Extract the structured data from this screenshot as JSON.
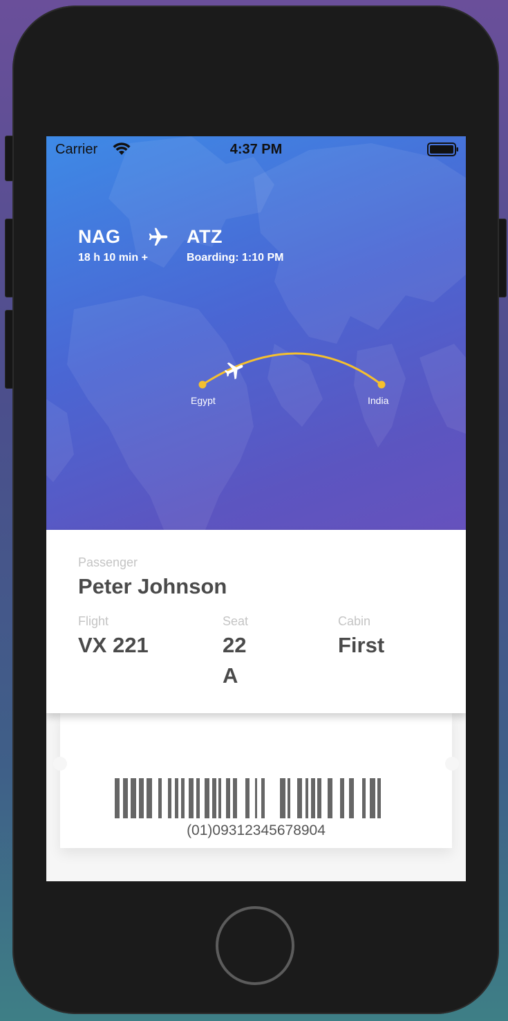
{
  "status_bar": {
    "carrier": "Carrier",
    "time": "4:37 PM",
    "icons": [
      "wifi-icon",
      "battery-icon"
    ]
  },
  "route": {
    "origin_code": "NAG",
    "origin_sub": "18 h 10 min +",
    "destination_code": "ATZ",
    "destination_sub": "Boarding: 1:10 PM",
    "icon": "airplane-icon"
  },
  "map": {
    "from_city": "Egypt",
    "to_city": "India",
    "path_color": "#f5c02e"
  },
  "ticket": {
    "passenger_label": "Passenger",
    "passenger_name": "Peter Johnson",
    "flight_label": "Flight",
    "flight_value": "VX 221",
    "seat_label": "Seat",
    "seat_value": "22 A",
    "cabin_label": "Cabin",
    "cabin_value": "First"
  },
  "barcode": {
    "number": "(01)09312345678904"
  },
  "colors": {
    "hero_top": "#3e8ae6",
    "hero_bottom": "#6652bd",
    "accent": "#f5c02e"
  }
}
